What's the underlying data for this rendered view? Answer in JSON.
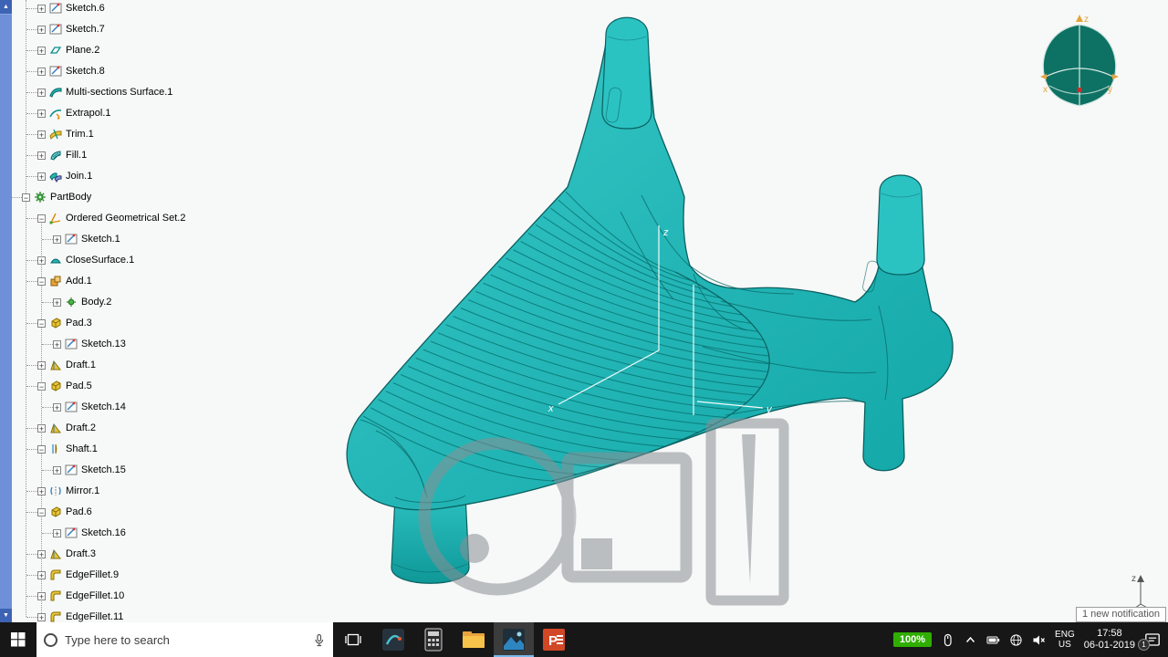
{
  "window": {
    "app": "CATIA part design view"
  },
  "colors": {
    "model_teal": "#1db6b6",
    "model_outline": "#0a6060",
    "battery_green": "#2fae00",
    "taskbar_bg": "#171717",
    "scrollbar_blue": "#5f83cc"
  },
  "tree": {
    "items": [
      {
        "label": "Sketch.6",
        "level": 1,
        "icon": "sketch",
        "expand": "plus"
      },
      {
        "label": "Sketch.7",
        "level": 1,
        "icon": "sketch",
        "expand": "plus"
      },
      {
        "label": "Plane.2",
        "level": 1,
        "icon": "plane",
        "expand": "plus"
      },
      {
        "label": "Sketch.8",
        "level": 1,
        "icon": "sketch",
        "expand": "plus"
      },
      {
        "label": "Multi-sections Surface.1",
        "level": 1,
        "icon": "multisection",
        "expand": "plus"
      },
      {
        "label": "Extrapol.1",
        "level": 1,
        "icon": "extrapol",
        "expand": "plus"
      },
      {
        "label": "Trim.1",
        "level": 1,
        "icon": "trim",
        "expand": "plus"
      },
      {
        "label": "Fill.1",
        "level": 1,
        "icon": "fill",
        "expand": "plus"
      },
      {
        "label": "Join.1",
        "level": 1,
        "icon": "join",
        "expand": "plus"
      },
      {
        "label": "PartBody",
        "level": 0,
        "icon": "partbody",
        "expand": "minus"
      },
      {
        "label": "Ordered Geometrical Set.2",
        "level": 1,
        "icon": "ogs",
        "expand": "minus"
      },
      {
        "label": "Sketch.1",
        "level": 2,
        "icon": "sketch",
        "expand": "plus"
      },
      {
        "label": "CloseSurface.1",
        "level": 1,
        "icon": "closesurface",
        "expand": "plus"
      },
      {
        "label": "Add.1",
        "level": 1,
        "icon": "add",
        "expand": "minus"
      },
      {
        "label": "Body.2",
        "level": 2,
        "icon": "body",
        "expand": "plus"
      },
      {
        "label": "Pad.3",
        "level": 1,
        "icon": "pad",
        "expand": "minus"
      },
      {
        "label": "Sketch.13",
        "level": 2,
        "icon": "sketch",
        "expand": "plus"
      },
      {
        "label": "Draft.1",
        "level": 1,
        "icon": "draft",
        "expand": "plus"
      },
      {
        "label": "Pad.5",
        "level": 1,
        "icon": "pad",
        "expand": "minus"
      },
      {
        "label": "Sketch.14",
        "level": 2,
        "icon": "sketch",
        "expand": "plus"
      },
      {
        "label": "Draft.2",
        "level": 1,
        "icon": "draft",
        "expand": "plus"
      },
      {
        "label": "Shaft.1",
        "level": 1,
        "icon": "shaft",
        "expand": "minus"
      },
      {
        "label": "Sketch.15",
        "level": 2,
        "icon": "sketch",
        "expand": "plus"
      },
      {
        "label": "Mirror.1",
        "level": 1,
        "icon": "mirror",
        "expand": "plus"
      },
      {
        "label": "Pad.6",
        "level": 1,
        "icon": "pad",
        "expand": "minus"
      },
      {
        "label": "Sketch.16",
        "level": 2,
        "icon": "sketch",
        "expand": "plus"
      },
      {
        "label": "Draft.3",
        "level": 1,
        "icon": "draft",
        "expand": "plus"
      },
      {
        "label": "EdgeFillet.9",
        "level": 1,
        "icon": "edgefillet",
        "expand": "plus"
      },
      {
        "label": "EdgeFillet.10",
        "level": 1,
        "icon": "edgefillet",
        "expand": "plus"
      },
      {
        "label": "EdgeFillet.11",
        "level": 1,
        "icon": "edgefillet",
        "expand": "plus"
      }
    ]
  },
  "model": {
    "axis_labels": {
      "x": "x",
      "y": "y",
      "z": "z"
    }
  },
  "compass": {
    "x": "x",
    "y": "y",
    "z": "z"
  },
  "view_triad": {
    "z": "z"
  },
  "tooltip": {
    "text": "1 new notification"
  },
  "taskbar": {
    "search_placeholder": "Type here to search",
    "tray": {
      "battery_percent": "100%",
      "lang_line1": "ENG",
      "lang_line2": "US",
      "time": "17:58",
      "date": "06-01-2019",
      "notification_badge": "1"
    }
  }
}
